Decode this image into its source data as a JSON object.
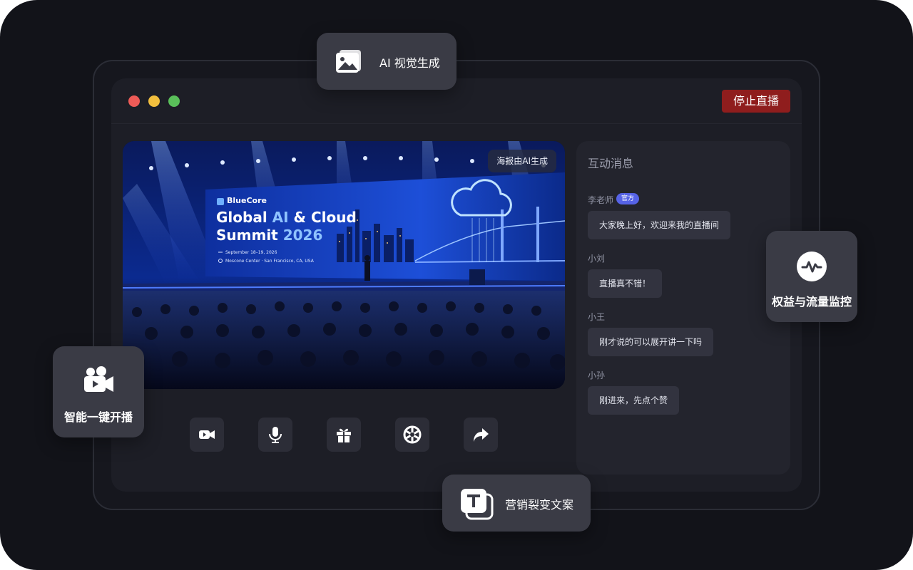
{
  "window": {
    "stop_live_label": "停止直播"
  },
  "video": {
    "ai_tag": "海报由AI生成",
    "poster": {
      "brand": "BlueCore",
      "title_line1_a": "Global ",
      "title_line1_b": "AI",
      "title_line1_c": " & Cloud",
      "title_line2_a": "Summit ",
      "title_line2_b": "2026",
      "date": "September 18–19, 2026",
      "venue": "Moscone Center · San Francisco, CA, USA"
    }
  },
  "controls": [
    {
      "icon": "video-camera-icon"
    },
    {
      "icon": "microphone-icon"
    },
    {
      "icon": "gift-icon"
    },
    {
      "icon": "lottery-wheel-icon"
    },
    {
      "icon": "share-icon"
    }
  ],
  "chat": {
    "title": "互动消息",
    "messages": [
      {
        "name": "李老师",
        "badge": "官方",
        "text": "大家晚上好，欢迎来我的直播间"
      },
      {
        "name": "小刘",
        "text": "直播真不错！"
      },
      {
        "name": "小王",
        "text": "刚才说的可以展开讲一下吗"
      },
      {
        "name": "小孙",
        "text": "刚进来，先点个赞"
      }
    ]
  },
  "features": {
    "ai_visual": "AI 视觉生成",
    "monitor": "权益与流量监控",
    "one_click_live": "智能一键开播",
    "marketing_copy": "营销裂变文案"
  },
  "colors": {
    "background": "#121319",
    "window": "#1d1e26",
    "stop_button": "#8f1d1d",
    "official_badge": "#5663e6",
    "feature_card": "#3a3b45"
  }
}
